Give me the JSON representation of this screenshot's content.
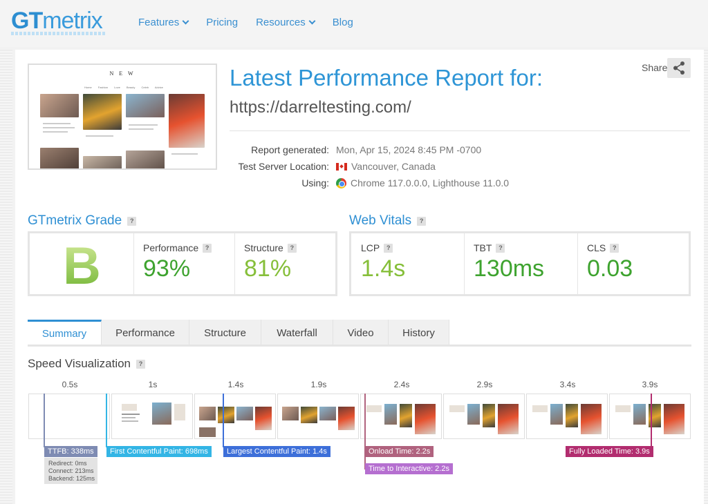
{
  "header": {
    "logo_gt": "GT",
    "logo_metrix": "metrix",
    "nav": [
      {
        "label": "Features",
        "has_dropdown": true
      },
      {
        "label": "Pricing",
        "has_dropdown": false
      },
      {
        "label": "Resources",
        "has_dropdown": true
      },
      {
        "label": "Blog",
        "has_dropdown": false
      }
    ]
  },
  "report": {
    "title": "Latest Performance Report for:",
    "url": "https://darreltesting.com/",
    "share_label": "Share",
    "thumbnail_site_name": "N E W",
    "thumbnail_menu": "Home Fashion Love Beauty Celeb Advice",
    "meta": [
      {
        "label": "Report generated:",
        "value": "Mon, Apr 15, 2024 8:45 PM -0700",
        "icon": ""
      },
      {
        "label": "Test Server Location:",
        "value": "Vancouver, Canada",
        "icon": "canada-flag-icon"
      },
      {
        "label": "Using:",
        "value": "Chrome 117.0.0.0, Lighthouse 11.0.0",
        "icon": "chrome-icon"
      }
    ]
  },
  "grade": {
    "title": "GTmetrix Grade",
    "letter": "B",
    "performance_label": "Performance",
    "performance_value": "93%",
    "structure_label": "Structure",
    "structure_value": "81%"
  },
  "vitals": {
    "title": "Web Vitals",
    "items": [
      {
        "label": "LCP",
        "value": "1.4s"
      },
      {
        "label": "TBT",
        "value": "130ms"
      },
      {
        "label": "CLS",
        "value": "0.03"
      }
    ]
  },
  "tabs": [
    "Summary",
    "Performance",
    "Structure",
    "Waterfall",
    "Video",
    "History"
  ],
  "active_tab": "Summary",
  "speed": {
    "title": "Speed Visualization",
    "ticks": [
      "0.5s",
      "1s",
      "1.4s",
      "1.9s",
      "2.4s",
      "2.9s",
      "3.4s",
      "3.9s"
    ],
    "markers": [
      {
        "label": "TTFB: 338ms",
        "color": "#7e8bb3"
      },
      {
        "label": "First Contentful Paint: 698ms",
        "color": "#33b5e5"
      },
      {
        "label": "Largest Contentful Paint: 1.4s",
        "color": "#3d6fd9"
      },
      {
        "label": "Onload Time: 2.2s",
        "color": "#b0627e"
      },
      {
        "label": "Time to Interactive: 2.2s",
        "color": "#b56fd0"
      },
      {
        "label": "Fully Loaded Time: 3.9s",
        "color": "#b22d6f"
      }
    ],
    "ttfb_detail": [
      "Redirect: 0ms",
      "Connect: 213ms",
      "Backend: 125ms"
    ]
  },
  "colors": {
    "brand_blue": "#2e8fd3",
    "good_green": "#3ea32f",
    "ok_green": "#86bf3a"
  }
}
